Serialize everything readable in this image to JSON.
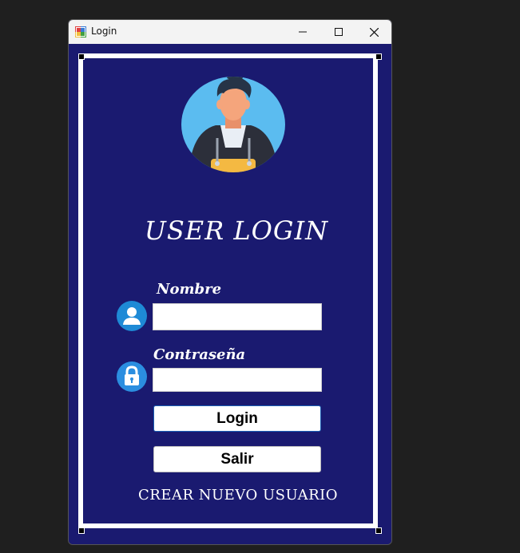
{
  "window": {
    "title": "Login",
    "controls": {
      "minimize": "minimize-icon",
      "maximize": "maximize-icon",
      "close": "close-icon"
    }
  },
  "form": {
    "heading": "USER LOGIN",
    "nombre_label": "Nombre",
    "nombre_value": "",
    "password_label": "Contraseña",
    "password_value": "",
    "login_button": "Login",
    "salir_button": "Salir",
    "create_link": "CREAR NUEVO USUARIO"
  },
  "colors": {
    "background": "#1a1a70",
    "icon_blue": "#1e8ad6",
    "text": "#ffffff"
  }
}
